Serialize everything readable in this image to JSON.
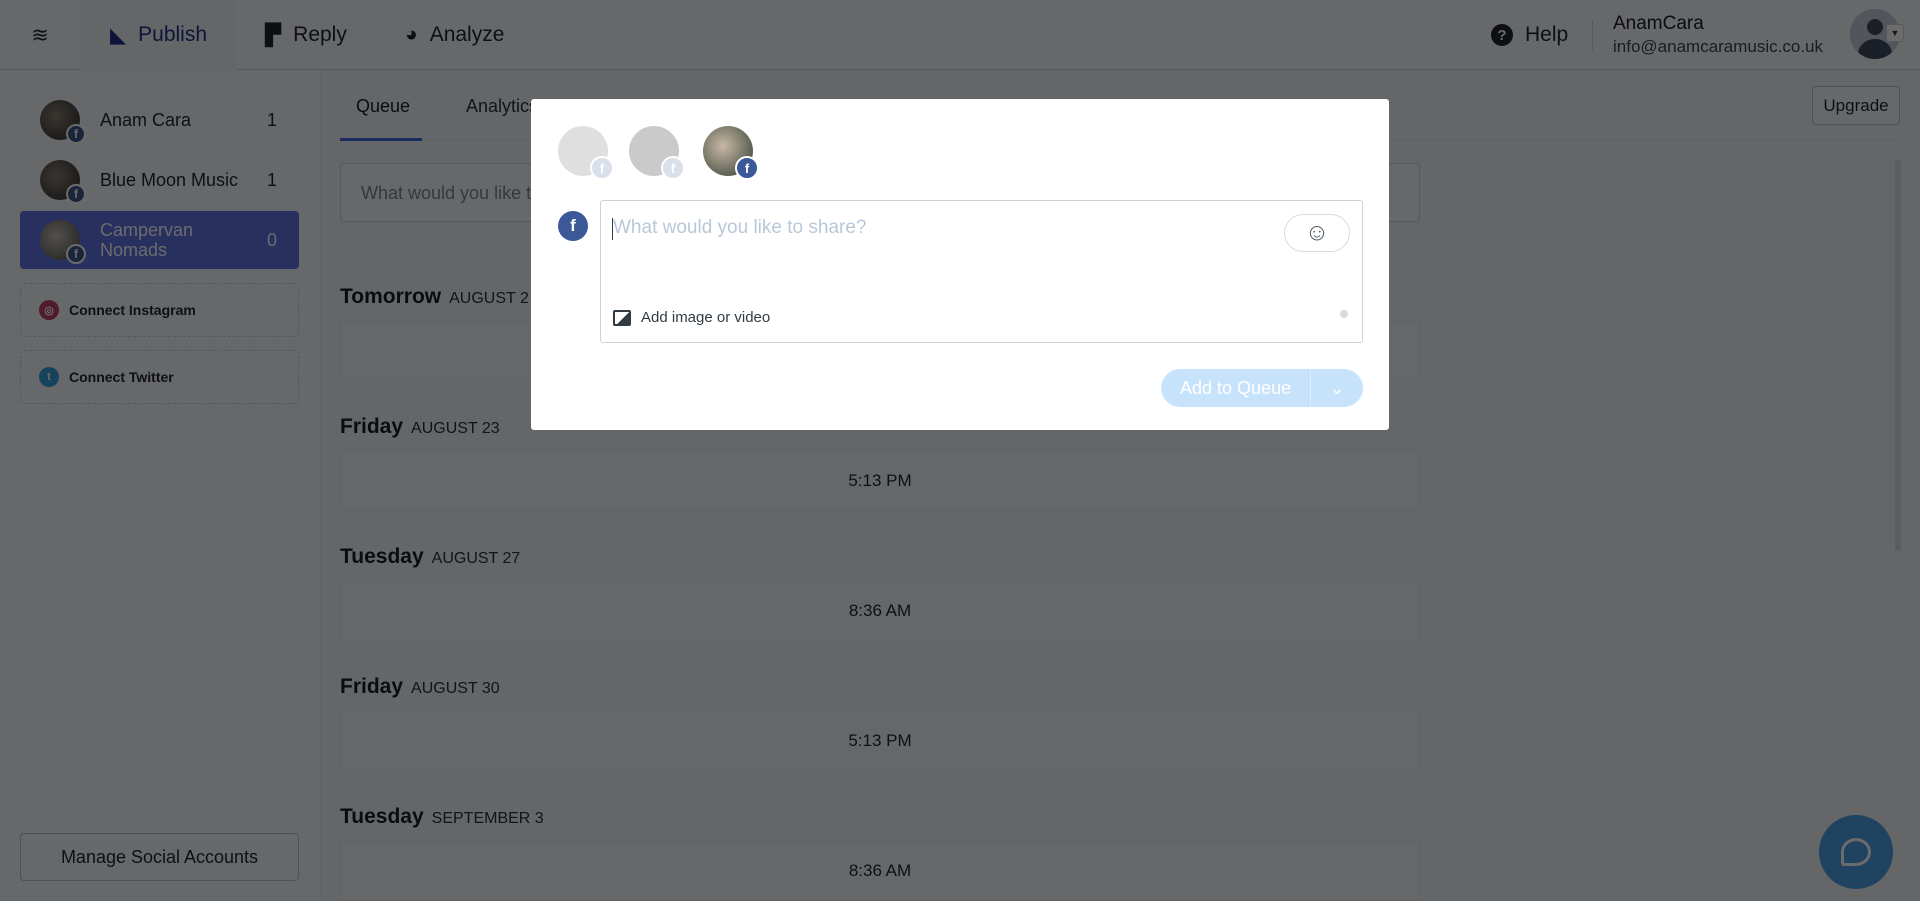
{
  "header": {
    "nav": [
      {
        "label": "Publish",
        "icon": "publish-icon"
      },
      {
        "label": "Reply",
        "icon": "reply-icon"
      },
      {
        "label": "Analyze",
        "icon": "pie-chart-icon"
      }
    ],
    "help": "Help",
    "user_name": "AnamCara",
    "user_email": "info@anamcaramusic.co.uk"
  },
  "sidebar": {
    "accounts": [
      {
        "name": "Anam Cara",
        "count": "1"
      },
      {
        "name": "Blue Moon Music",
        "count": "1"
      },
      {
        "name": "Campervan Nomads",
        "count": "0",
        "selected": true
      }
    ],
    "connect_instagram": "Connect Instagram",
    "connect_twitter": "Connect Twitter",
    "manage": "Manage Social Accounts"
  },
  "main": {
    "tabs": [
      "Queue",
      "Analytics"
    ],
    "composer_placeholder": "What would you like to share?",
    "upgrade": "Upgrade",
    "days": [
      {
        "day": "Tomorrow",
        "date": "AUGUST 2",
        "slot": ""
      },
      {
        "day": "Friday",
        "date": "AUGUST 23",
        "slot": "5:13 PM"
      },
      {
        "day": "Tuesday",
        "date": "AUGUST 27",
        "slot": "8:36 AM"
      },
      {
        "day": "Friday",
        "date": "AUGUST 30",
        "slot": "5:13 PM"
      },
      {
        "day": "Tuesday",
        "date": "SEPTEMBER 3",
        "slot": "8:36 AM"
      }
    ]
  },
  "modal": {
    "placeholder": "What would you like to share?",
    "add_media": "Add image or video",
    "submit": "Add to Queue"
  },
  "colors": {
    "accent": "#3c55d8",
    "facebook": "#3b5998",
    "button_disabled": "#c7e3fb"
  }
}
